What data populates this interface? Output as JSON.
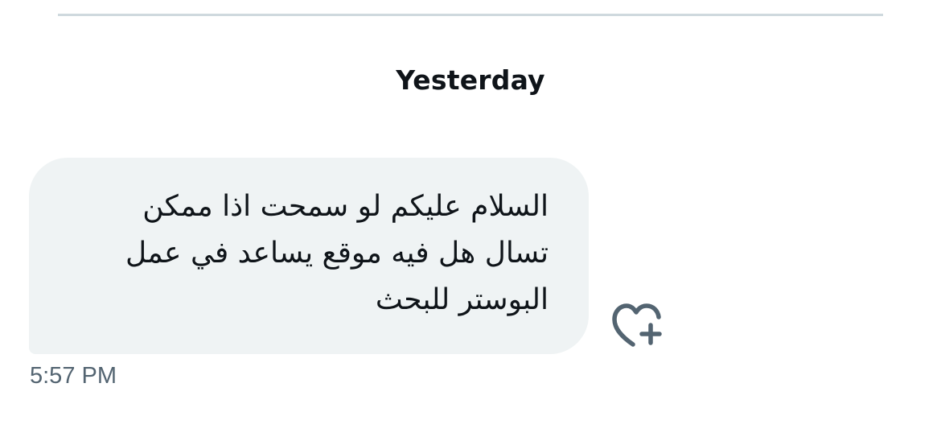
{
  "conversation": {
    "day_separator": "Yesterday",
    "messages": [
      {
        "text": "السلام عليكم  لو سمحت اذا ممكن\nتسال هل فيه موقع يساعد في عمل\nالبوستر للبحث",
        "timestamp": "5:57 PM",
        "direction": "rtl"
      }
    ]
  },
  "icons": {
    "reaction": "heart-plus-icon"
  },
  "colors": {
    "bubble_background": "#eff3f4",
    "text_primary": "#0f1419",
    "text_secondary": "#536471",
    "divider": "#cfd9de"
  }
}
